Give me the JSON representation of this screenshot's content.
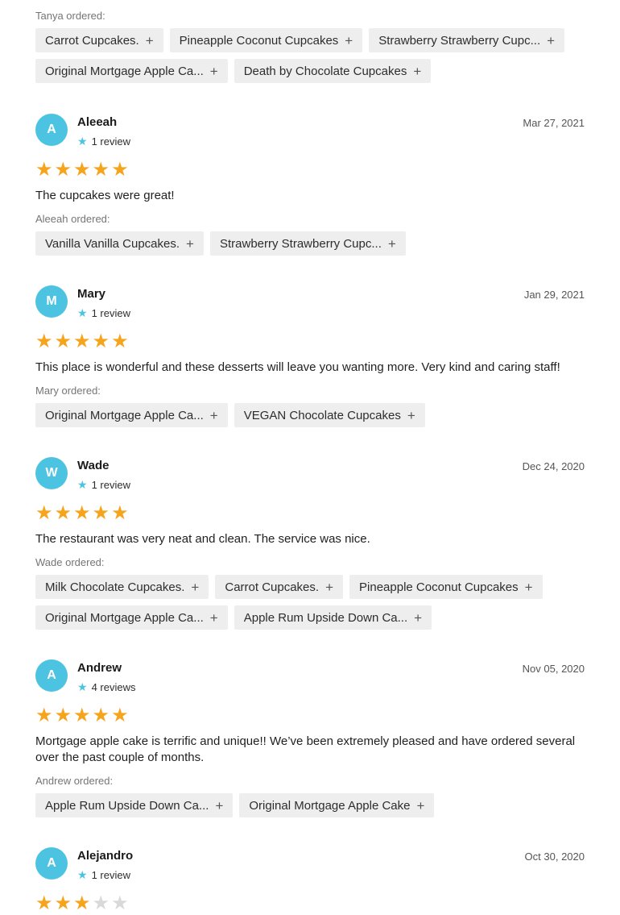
{
  "top_order": {
    "label": "Tanya ordered:",
    "items": [
      "Carrot Cupcakes.",
      "Pineapple Coconut Cupcakes",
      "Strawberry Strawberry Cupc...",
      "Original Mortgage Apple Ca...",
      "Death by Chocolate Cupcakes"
    ]
  },
  "reviews": [
    {
      "initial": "A",
      "name": "Aleeah",
      "count": "1 review",
      "date": "Mar 27, 2021",
      "rating": 5,
      "text": "The cupcakes were great!",
      "ordered_label": "Aleeah ordered:",
      "items": [
        "Vanilla Vanilla Cupcakes.",
        "Strawberry Strawberry Cupc..."
      ]
    },
    {
      "initial": "M",
      "name": "Mary",
      "count": "1 review",
      "date": "Jan 29, 2021",
      "rating": 5,
      "text": "This place is wonderful and these desserts will leave you wanting more. Very kind and caring staff!",
      "ordered_label": "Mary ordered:",
      "items": [
        "Original Mortgage Apple Ca...",
        "VEGAN Chocolate Cupcakes"
      ]
    },
    {
      "initial": "W",
      "name": "Wade",
      "count": "1 review",
      "date": "Dec 24, 2020",
      "rating": 5,
      "text": "The restaurant was very neat and clean. The service was nice.",
      "ordered_label": "Wade ordered:",
      "items": [
        "Milk Chocolate Cupcakes.",
        "Carrot Cupcakes.",
        "Pineapple Coconut Cupcakes",
        "Original Mortgage Apple Ca...",
        "Apple Rum Upside Down Ca..."
      ]
    },
    {
      "initial": "A",
      "name": "Andrew",
      "count": "4 reviews",
      "date": "Nov 05, 2020",
      "rating": 5,
      "text": "Mortgage apple cake is terrific and unique!! We’ve been extremely pleased and have ordered several over the past couple of months.",
      "ordered_label": "Andrew ordered:",
      "items": [
        "Apple Rum Upside Down Ca...",
        "Original Mortgage Apple Cake"
      ]
    },
    {
      "initial": "A",
      "name": "Alejandro",
      "count": "1 review",
      "date": "Oct 30, 2020",
      "rating": 3,
      "text": "",
      "ordered_label": "",
      "items": []
    }
  ],
  "colors": {
    "avatar": "#4cc3e1",
    "star_on": "#f7a41d",
    "star_off": "#d9d9d9",
    "chip_bg": "#eeeeee"
  },
  "icons": {
    "chip_add": "plus-icon",
    "review_count": "star-icon",
    "rating": "star-icon"
  }
}
